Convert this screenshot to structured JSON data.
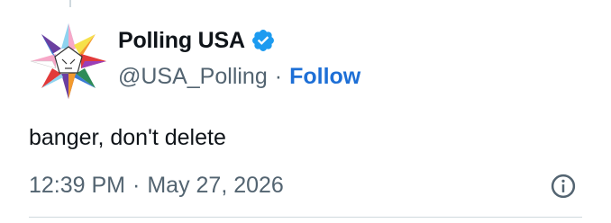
{
  "author": {
    "display_name": "Polling USA",
    "handle": "@USA_Polling",
    "verified": true,
    "verified_icon": "verified-badge-icon"
  },
  "follow_label": "Follow",
  "separator": "·",
  "tweet": {
    "text": "banger, don't delete",
    "time": "12:39 PM",
    "date": "May 27, 2026"
  },
  "icons": {
    "info": "info-icon",
    "avatar": "rainbow-star-logo"
  },
  "colors": {
    "link": "#1d6fd6",
    "verified": "#1d9bf0",
    "muted": "#536471",
    "text": "#0f1419"
  }
}
